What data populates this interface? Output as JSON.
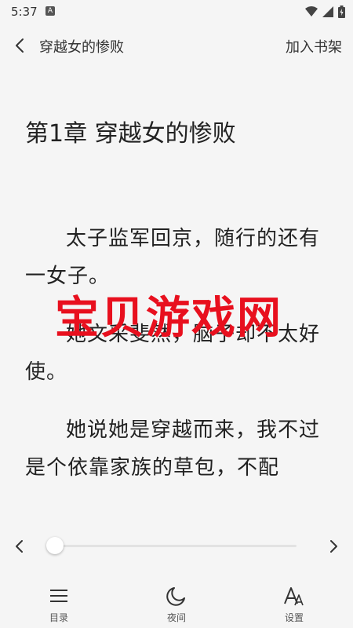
{
  "status_bar": {
    "time": "5:37",
    "notification_letter": "A"
  },
  "top_bar": {
    "title": "穿越女的惨败",
    "add_to_shelf": "加入书架"
  },
  "chapter": {
    "title": "第1章 穿越女的惨败",
    "paragraphs": [
      "太子监军回京，随行的还有一女子。",
      "她文采斐然，脑子却不太好使。",
      "她说她是穿越而来，我不过是个依靠家族的草包，不配"
    ]
  },
  "watermark": "宝贝游戏网",
  "progress": {
    "value": 0.0
  },
  "bottom_nav": {
    "toc_label": "目录",
    "night_label": "夜间",
    "settings_label": "设置"
  }
}
